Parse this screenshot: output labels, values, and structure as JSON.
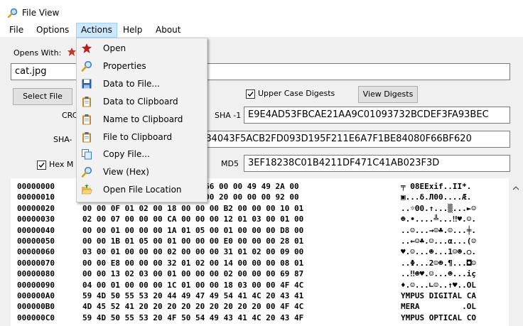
{
  "window": {
    "title": "File View"
  },
  "menubar": {
    "items": [
      "File",
      "Options",
      "Actions",
      "Help",
      "About"
    ]
  },
  "form": {
    "opens_with_label": "Opens With:",
    "filename_value": "cat.jpg",
    "select_file_label": "Select File",
    "upper_case_label": "Upper Case Digests",
    "view_digests_label": "View Digests",
    "crc_label": "CRC",
    "sha1_label": "SHA -1",
    "sha1_value": "E9E4AD53FBCAE21AA9C01093732BCDEF3FA93BEC",
    "sha2_label": "SHA-",
    "sha2_value": "984043F5ACB2FD093D195F211E6A7F1BE84080F66BF620",
    "md5_label": "MD5",
    "md5_value": "3EF18238C01B4211DF471C41AB023F3D",
    "hex_mode_label": "Hex M",
    "upper_case_checked": true,
    "hex_mode_checked": true
  },
  "dropdown": {
    "items": [
      {
        "label": "Open",
        "icon": "open-app-icon"
      },
      {
        "label": "Properties",
        "icon": "magnifier-icon"
      },
      {
        "label": "Data to File...",
        "icon": "save-disk-icon"
      },
      {
        "label": "Data to Clipboard",
        "icon": "clipboard-icon"
      },
      {
        "label": "Name to Clipboard",
        "icon": "clipboard-icon"
      },
      {
        "label": "File to Clipboard",
        "icon": "clipboard-icon"
      },
      {
        "label": "Copy File...",
        "icon": "copy-icon"
      },
      {
        "label": "View (Hex)",
        "icon": "magnifier-icon"
      },
      {
        "label": "Open File Location",
        "icon": "folder-open-icon"
      }
    ]
  },
  "hex": {
    "rows": [
      {
        "offset": "00000000",
        "hex": "                  5 78 69 66 00 00 49 49 2A 00",
        "ascii": "╤ Θ8EExif..II*."
      },
      {
        "offset": "00000010",
        "hex": "                  2 01 02 00 20 00 00 00 92 00",
        "ascii": "▣...δ.Л00....Æ."
      },
      {
        "offset": "00000020",
        "hex": "00 00 0F 01 02 00 18 00 00 00 B2 00 00 00 10 01",
        "ascii": "..☼Θ0.↑...▒...►☺"
      },
      {
        "offset": "00000030",
        "hex": "02 00 07 00 00 00 CA 00 00 00 12 01 03 00 01 00",
        "ascii": "☻.•....╩...‼♥.☺."
      },
      {
        "offset": "00000040",
        "hex": "00 00 01 00 00 00 1A 01 05 00 01 00 00 00 D8 00",
        "ascii": "..☺...→☺♣.☺...╪."
      },
      {
        "offset": "00000050",
        "hex": "00 00 1B 01 05 00 01 00 00 00 E0 00 00 00 28 01",
        "ascii": "..←☺♣.☺...α...(☺"
      },
      {
        "offset": "00000060",
        "hex": "03 00 01 00 00 00 02 00 00 00 31 01 02 00 09 00",
        "ascii": "♥.☺...☻...1☺☻.○."
      },
      {
        "offset": "00000070",
        "hex": "00 00 E8 00 00 00 32 01 02 00 14 00 00 00 08 01",
        "ascii": "..Φ...2☺☻.¶...◘☺"
      },
      {
        "offset": "00000080",
        "hex": "00 00 13 02 03 00 01 00 00 00 02 00 00 00 69 87",
        "ascii": "..‼☻♥.☺...☻...iç"
      },
      {
        "offset": "00000090",
        "hex": "04 00 01 00 00 00 1C 01 00 00 18 03 00 00 4F 4C",
        "ascii": "♦.☺...∟☺..↑♥..OL"
      },
      {
        "offset": "000000A0",
        "hex": "59 4D 50 55 53 20 44 49 47 49 54 41 4C 20 43 41",
        "ascii": "YMPUS DIGITAL CA"
      },
      {
        "offset": "000000B0",
        "hex": "4D 45 52 41 20 20 20 20 20 20 20 20 20 00 4F 4C",
        "ascii": "MERA         .OL"
      },
      {
        "offset": "000000C0",
        "hex": "59 4D 50 55 53 20 4F 50 54 49 43 41 4C 20 43 4F",
        "ascii": "YMPUS OPTICAL CO"
      }
    ]
  }
}
